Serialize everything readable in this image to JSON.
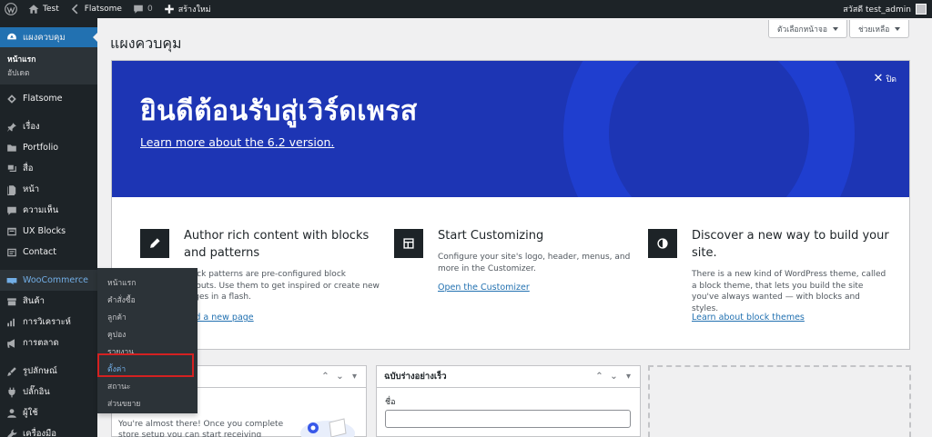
{
  "adminbar": {
    "site_name": "Test",
    "theme_name": "Flatsome",
    "comments_count": "0",
    "new_label": "สร้างใหม่",
    "greeting": "สวัสดี test_admin"
  },
  "sidebar": {
    "dashboard": "แผงควบคุม",
    "dashboard_sub": [
      "หน้าแรก",
      "อัปเดต"
    ],
    "items": [
      {
        "label": "Flatsome",
        "icon": "flatsome-icon"
      },
      {
        "label": "เรื่อง",
        "icon": "pin-icon"
      },
      {
        "label": "Portfolio",
        "icon": "folder-icon"
      },
      {
        "label": "สื่อ",
        "icon": "media-icon"
      },
      {
        "label": "หน้า",
        "icon": "page-icon"
      },
      {
        "label": "ความเห็น",
        "icon": "comment-icon"
      },
      {
        "label": "UX Blocks",
        "icon": "blocks-icon"
      },
      {
        "label": "Contact",
        "icon": "mail-icon"
      },
      {
        "label": "WooCommerce",
        "icon": "woocommerce-icon"
      },
      {
        "label": "สินค้า",
        "icon": "products-icon"
      },
      {
        "label": "การวิเคราะห์",
        "icon": "analytics-icon"
      },
      {
        "label": "การตลาด",
        "icon": "megaphone-icon"
      },
      {
        "label": "รูปลักษณ์",
        "icon": "brush-icon"
      },
      {
        "label": "ปลั๊กอิน",
        "icon": "plugin-icon"
      },
      {
        "label": "ผู้ใช้",
        "icon": "user-icon"
      },
      {
        "label": "เครื่องมือ",
        "icon": "wrench-icon"
      }
    ]
  },
  "flyout": [
    "หน้าแรก",
    "คำสั่งซื้อ",
    "ลูกค้า",
    "คูปอง",
    "รายงาน",
    "ตั้งค่า",
    "สถานะ",
    "ส่วนขยาย"
  ],
  "header": {
    "page_title": "แผงควบคุม",
    "screen_options": "ตัวเลือกหน้าจอ",
    "help": "ช่วยเหลือ"
  },
  "welcome": {
    "title": "ยินดีต้อนรับสู่เวิร์ดเพรส",
    "link": "Learn more about the 6.2 version.",
    "dismiss": "ปิด",
    "columns": [
      {
        "title": "Author rich content with blocks and patterns",
        "desc": "Block patterns are pre-configured block layouts. Use them to get inspired or create new pages in a flash.",
        "link": "Add a new page",
        "icon": "pencil-icon"
      },
      {
        "title": "Start Customizing",
        "desc": "Configure your site's logo, header, menus, and more in the Customizer.",
        "link": "Open the Customizer",
        "icon": "layout-icon"
      },
      {
        "title": "Discover a new way to build your site.",
        "desc": "There is a new kind of WordPress theme, called a block theme, that lets you build the site you've always wanted — with blocks and styles.",
        "link": "Learn about block themes",
        "icon": "contrast-icon"
      }
    ]
  },
  "postboxes": {
    "woo_text": "You're almost there! Once you complete store setup you can start receiving orders.",
    "quick_draft_title": "ฉบับร่างอย่างเร็ว",
    "quick_draft_label": "ชื่อ"
  },
  "colors": {
    "admin_bg": "#1d2327",
    "accent": "#2271b1",
    "welcome_bg": "#1d35b4",
    "highlight": "#d42121"
  }
}
